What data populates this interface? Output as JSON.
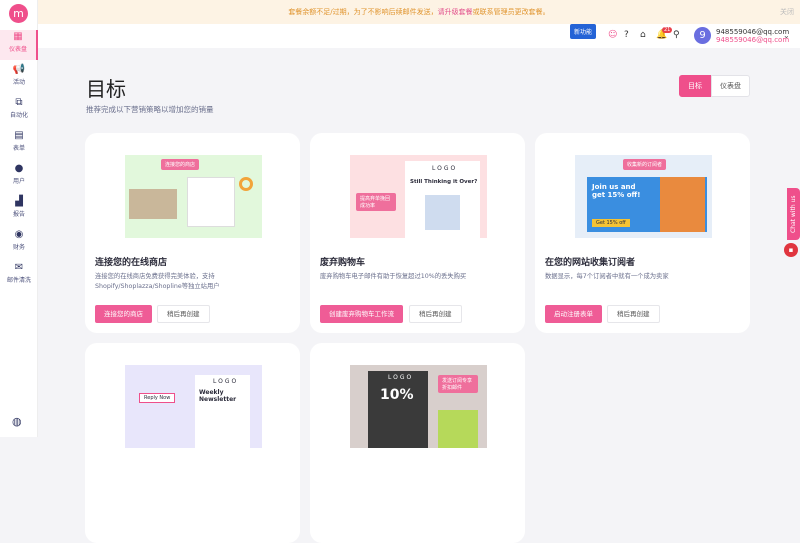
{
  "banner": {
    "text": "套餐余额不足/过期，为了不影响后续邮件发送，",
    "link": "请升级套餐",
    "text2": "或联系管理员更改套餐。",
    "close": "关闭"
  },
  "sidebar": {
    "logo": "m",
    "items": [
      {
        "label": "仪表盘",
        "icon": "grid-icon"
      },
      {
        "label": "活动",
        "icon": "megaphone-icon"
      },
      {
        "label": "自动化",
        "icon": "hierarchy-icon"
      },
      {
        "label": "表单",
        "icon": "form-icon"
      },
      {
        "label": "用户",
        "icon": "user-icon"
      },
      {
        "label": "报告",
        "icon": "chart-icon"
      },
      {
        "label": "财务",
        "icon": "moneybag-icon"
      },
      {
        "label": "邮件清洗",
        "icon": "mail-clean-icon"
      }
    ]
  },
  "header": {
    "new_feature": "新功能",
    "notif_count": "21",
    "avatar": "9",
    "email1": "948559046@qq.com",
    "email2": "948559046@qq.com"
  },
  "page": {
    "title": "目标",
    "subtitle": "推荐完成以下营销策略以增加您的销量",
    "tabs": [
      "目标",
      "仪表盘"
    ]
  },
  "cards": [
    {
      "title": "连接您的在线商店",
      "desc": "连接您的在线商店免费获得完美体验，支持Shopify/Shoplazza/Shopline等独立站用户",
      "primary": "连接您的商店",
      "secondary": "稍后再创建",
      "img_label": "连接您的商店",
      "img_color": "#e2f8dc"
    },
    {
      "title": "废弃购物车",
      "desc": "废弃购物车电子邮件有助于恢复超过10%的丢失购买",
      "primary": "创建废弃购物车工作流",
      "secondary": "稍后再创建",
      "img_label": "提高弃单挽回成功率",
      "img_text": "Still Thinking it Over?",
      "img_logo": "LOGO",
      "img_color": "#fde0e2"
    },
    {
      "title": "在您的网站收集订阅者",
      "desc": "数据显示，每7个订阅者中就有一个成为卖家",
      "primary": "启动注册表单",
      "secondary": "稍后再创建",
      "img_label": "收集新的订阅者",
      "img_text": "Join us and get 15% off!",
      "img_btn": "Get 15% off",
      "img_color": "#e6eef8"
    },
    {
      "img_text": "Weekly Newsletter",
      "img_pill": "Reply Now",
      "img_logo": "LOGO",
      "img_color": "#e8e6fb"
    },
    {
      "img_text": "10%",
      "img_label": "发送订阅专享折扣邮件",
      "img_logo": "LOGO",
      "img_color": "#d8cfcc"
    }
  ],
  "chat": {
    "label": "Chat with us"
  }
}
